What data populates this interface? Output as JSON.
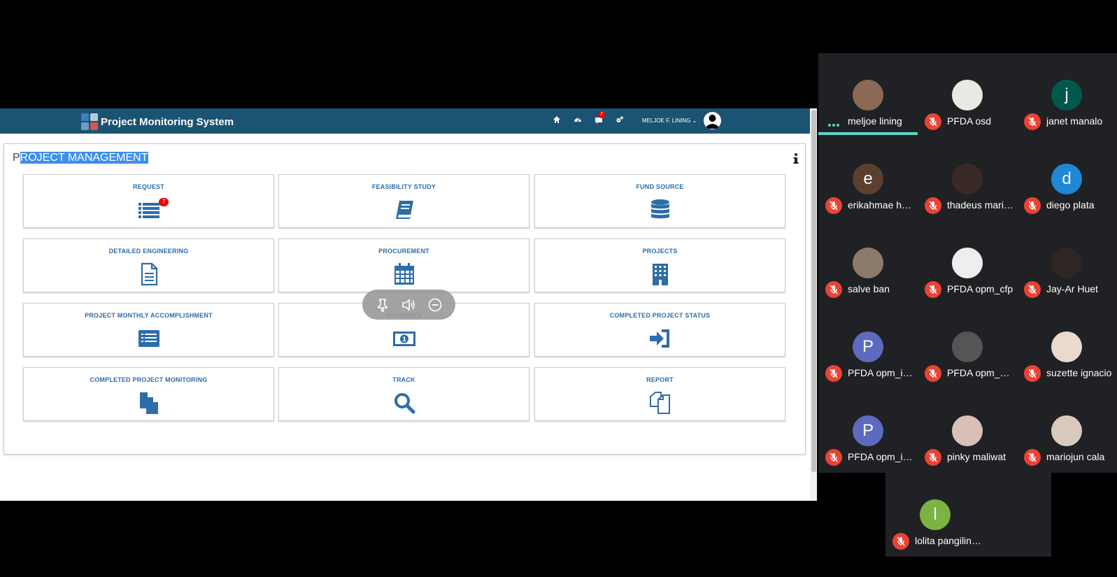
{
  "app": {
    "title": "Project Monitoring System",
    "nav_badge": "7",
    "user_name": "MELJOE F. LINING"
  },
  "panel": {
    "title_first": "P",
    "title_rest": "ROJECT MANAGEMENT"
  },
  "tiles": [
    {
      "label": "REQUEST",
      "icon": "list-icon",
      "badge": "7"
    },
    {
      "label": "FEASIBILITY STUDY",
      "icon": "book-icon"
    },
    {
      "label": "FUND SOURCE",
      "icon": "database-icon"
    },
    {
      "label": "DETAILED ENGINEERING",
      "icon": "document-icon"
    },
    {
      "label": "PROCUREMENT",
      "icon": "calendar-icon"
    },
    {
      "label": "PROJECTS",
      "icon": "building-icon"
    },
    {
      "label": "PROJECT MONTHLY ACCOMPLISHMENT",
      "icon": "list-alt-icon"
    },
    {
      "label": "PAYMENTS",
      "icon": "money-icon"
    },
    {
      "label": "COMPLETED PROJECT STATUS",
      "icon": "sign-in-icon"
    },
    {
      "label": "COMPLETED PROJECT MONITORING",
      "icon": "copy-icon"
    },
    {
      "label": "TRACK",
      "icon": "search-icon"
    },
    {
      "label": "REPORT",
      "icon": "files-icon"
    }
  ],
  "participants": [
    {
      "name": "meljoe lining",
      "initial": "",
      "color": "#8a6a55",
      "speaking": true
    },
    {
      "name": "PFDA osd",
      "initial": "",
      "color": "#e9e9e4"
    },
    {
      "name": "janet manalo",
      "initial": "j",
      "color": "#00594f"
    },
    {
      "name": "erikahmae hes...",
      "initial": "e",
      "color": "#5b4030"
    },
    {
      "name": "thadeus maria...",
      "initial": "",
      "color": "#3a2a26"
    },
    {
      "name": "diego plata",
      "initial": "d",
      "color": "#1e88d6"
    },
    {
      "name": "salve ban",
      "initial": "",
      "color": "#8c7a6b"
    },
    {
      "name": "PFDA opm_cfp",
      "initial": "",
      "color": "#eee"
    },
    {
      "name": "Jay-Ar Huet",
      "initial": "",
      "color": "#2d2622"
    },
    {
      "name": "PFDA opm_ifpc",
      "initial": "P",
      "color": "#5c6bc0"
    },
    {
      "name": "PFDA opm_zfpc",
      "initial": "",
      "color": "#555"
    },
    {
      "name": "suzette ignacio",
      "initial": "",
      "color": "#e9d9cf"
    },
    {
      "name": "PFDA opm_ifpc",
      "initial": "P",
      "color": "#5c6bc0"
    },
    {
      "name": "pinky maliwat",
      "initial": "",
      "color": "#d9c0b7"
    },
    {
      "name": "mariojun cala",
      "initial": "",
      "color": "#d9c9bd"
    },
    {
      "name": "lolita pangilinan",
      "initial": "l",
      "color": "#7cb342"
    }
  ]
}
